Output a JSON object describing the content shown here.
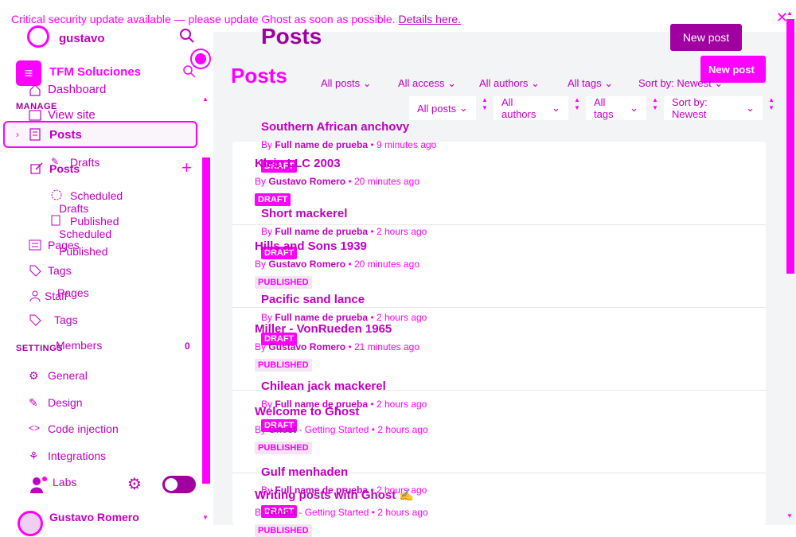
{
  "banner": {
    "text": "Critical security update available — please update Ghost as soon as possible.",
    "link": "Details here."
  },
  "sidebar": {
    "user": "gustavo",
    "site_name": "TFM Soluciones",
    "dashboard": "Dashboard",
    "manage_head": "MANAGE",
    "view_site": "View site",
    "posts": "Posts",
    "posts2": "Posts",
    "drafts_a": "Drafts",
    "drafts_b": "Drafts",
    "scheduled_a": "Scheduled",
    "scheduled_b": "Scheduled",
    "published_a": "Published",
    "published_b": "Published",
    "pages_a": "Pages",
    "pages_b": "Pages",
    "tags_a": "Tags",
    "tags_b": "Tags",
    "staff": "Staff",
    "members": "Members",
    "members_count": "0",
    "settings_head": "SETTINGS",
    "general": "General",
    "design": "Design",
    "code_injection": "Code injection",
    "integrations": "Integrations",
    "labs": "Labs",
    "footer_user": "Gustavo Romero"
  },
  "header": {
    "title_back": "Posts",
    "title_front": "Posts",
    "new_post_back": "New post",
    "new_post_front": "New post"
  },
  "filters_back": {
    "all_posts": "All posts",
    "all_access": "All access",
    "all_authors": "All authors",
    "all_tags": "All tags",
    "sort": "Sort by: Newest"
  },
  "filters_front": {
    "all_posts": "All posts",
    "all_authors": "All authors",
    "all_tags": "All tags",
    "sort": "Sort by: Newest"
  },
  "posts_back": [
    {
      "title": "Southern African anchovy",
      "author": "Full name de prueba",
      "time": "9 minutes ago",
      "badge": "DRAFT"
    },
    {
      "title": "Short mackerel",
      "author": "Full name de prueba",
      "time": "2 hours ago",
      "badge": "DRAFT"
    },
    {
      "title": "Pacific sand lance",
      "author": "Full name de prueba",
      "time": "2 hours ago",
      "badge": "DRAFT"
    },
    {
      "title": "Chilean jack mackerel",
      "author": "Full name de prueba",
      "time": "2 hours ago",
      "badge": "DRAFT"
    },
    {
      "title": "Gulf menhaden",
      "author": "Full name de prueba",
      "time": "2 hours ago",
      "badge": "DRAFT"
    }
  ],
  "posts_front": [
    {
      "title": "Klein LLC 2003",
      "author": "Gustavo Romero",
      "time": "20 minutes ago",
      "badge": "DRAFT"
    },
    {
      "title": "Hills and Sons 1939",
      "author": "Gustavo Romero",
      "time": "20 minutes ago",
      "badge": "PUBLISHED"
    },
    {
      "title": "Miller - VonRueden 1965",
      "author": "Gustavo Romero",
      "time": "21 minutes ago",
      "badge": "PUBLISHED"
    },
    {
      "title": "Welcome to Ghost",
      "author": "Ghost",
      "author_suffix": " - Getting Started",
      "time": "2 hours ago",
      "badge": "PUBLISHED"
    },
    {
      "title": "Writing posts with Ghost ✍️",
      "author": "Ghost",
      "author_suffix": " - Getting Started",
      "time": "2 hours ago",
      "badge": "PUBLISHED"
    }
  ],
  "labels": {
    "by": "By",
    "dot": "•"
  },
  "colors": {
    "accent": "#ff00ff",
    "accent_dark": "#c000c0"
  }
}
